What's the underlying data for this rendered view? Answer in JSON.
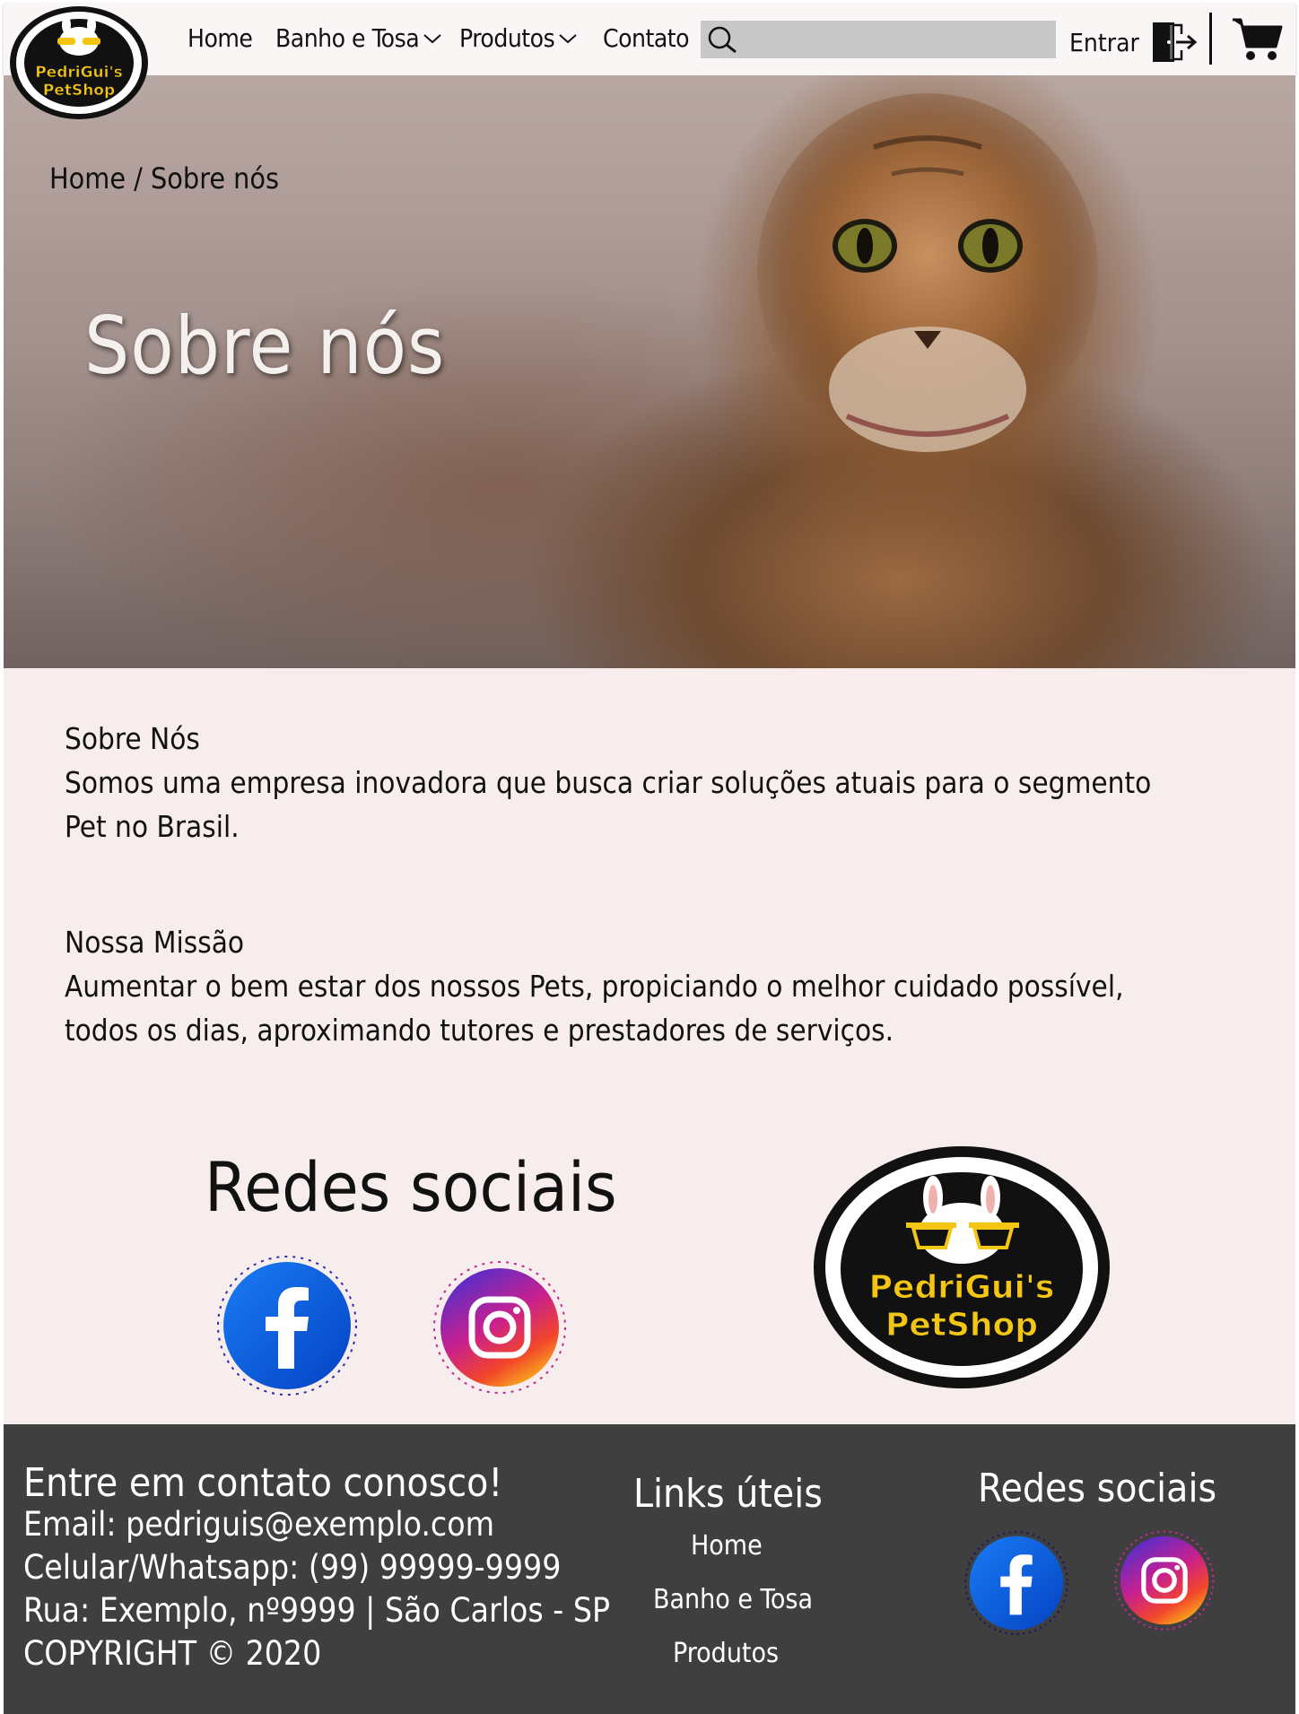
{
  "nav": {
    "logo_line1": "PedriGui's",
    "logo_line2": "PetShop",
    "home": "Home",
    "banho": "Banho e Tosa",
    "produtos": "Produtos",
    "contato": "Contato",
    "search_placeholder": "",
    "login": "Entrar"
  },
  "hero": {
    "breadcrumb": "Home / Sobre nós",
    "title": "Sobre nós"
  },
  "content": {
    "about_heading": "Sobre Nós",
    "about_text_1": "Somos uma empresa inovadora que busca criar soluções atuais para o segmento",
    "about_text_2": "Pet no Brasil.",
    "mission_heading": "Nossa Missão",
    "mission_text_1": "Aumentar o bem estar dos nossos Pets, propiciando o melhor cuidado possível,",
    "mission_text_2": "todos os dias, aproximando tutores e prestadores de serviços.",
    "social_title": "Redes sociais"
  },
  "footer": {
    "contact_heading": "Entre em contato conosco!",
    "email": "Email: pedriguis@exemplo.com",
    "phone": "Celular/Whatsapp: (99) 99999-9999",
    "address": "Rua: Exemplo, nº9999 | São Carlos - SP",
    "copyright": "COPYRIGHT © 2020",
    "links_title": "Links úteis",
    "links": [
      "Home",
      "Banho e Tosa",
      "Produtos"
    ],
    "social_title": "Redes sociais"
  },
  "icons": {
    "search": "search-icon",
    "login": "door-enter-icon",
    "cart": "cart-icon",
    "facebook": "facebook-icon",
    "instagram": "instagram-icon",
    "chevron": "chevron-down-icon"
  },
  "colors": {
    "nav_bg": "#fbf6f6",
    "content_bg": "#f7eded",
    "footer_bg": "#3f3f3f",
    "logo_yellow": "#f3c614",
    "facebook_blue": "#0a5ad8"
  }
}
